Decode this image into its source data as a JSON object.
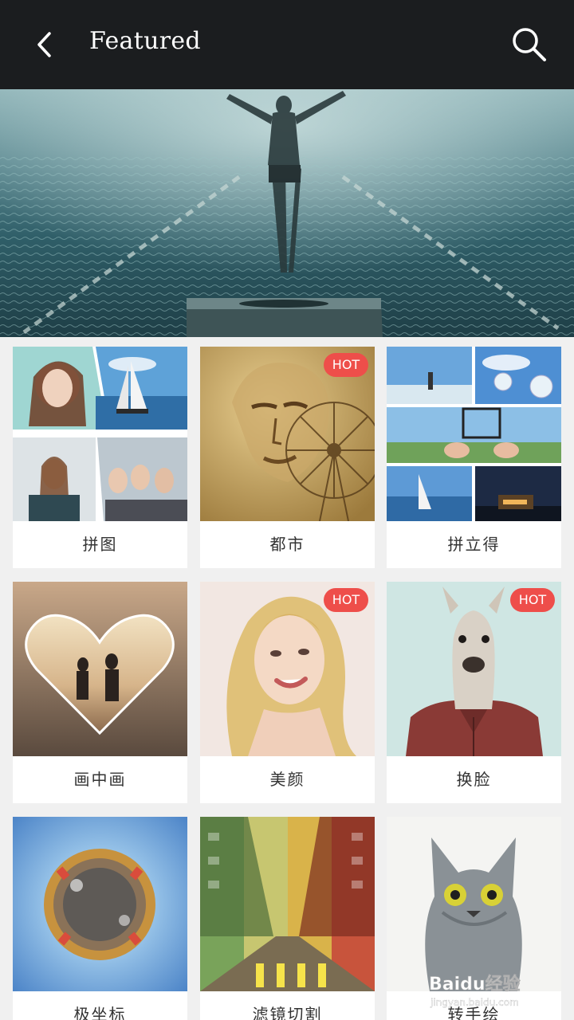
{
  "header": {
    "title": "Featured",
    "back_icon": "chevron-left-icon",
    "search_icon": "search-icon"
  },
  "badge": {
    "hot": "HOT"
  },
  "cards": [
    {
      "label": "拼图",
      "hot": false
    },
    {
      "label": "都市",
      "hot": true
    },
    {
      "label": "拼立得",
      "hot": false
    },
    {
      "label": "画中画",
      "hot": false
    },
    {
      "label": "美颜",
      "hot": true
    },
    {
      "label": "换脸",
      "hot": true
    },
    {
      "label": "极坐标",
      "hot": false
    },
    {
      "label": "滤镜切割",
      "hot": false
    },
    {
      "label": "转手绘",
      "hot": false
    }
  ],
  "watermark": {
    "brand": "Baidu经验",
    "url": "jingyan.baidu.com"
  },
  "colors": {
    "topbar": "#1b1d1f",
    "hot_badge": "#ee4e4a",
    "background": "#f0f0f0"
  }
}
